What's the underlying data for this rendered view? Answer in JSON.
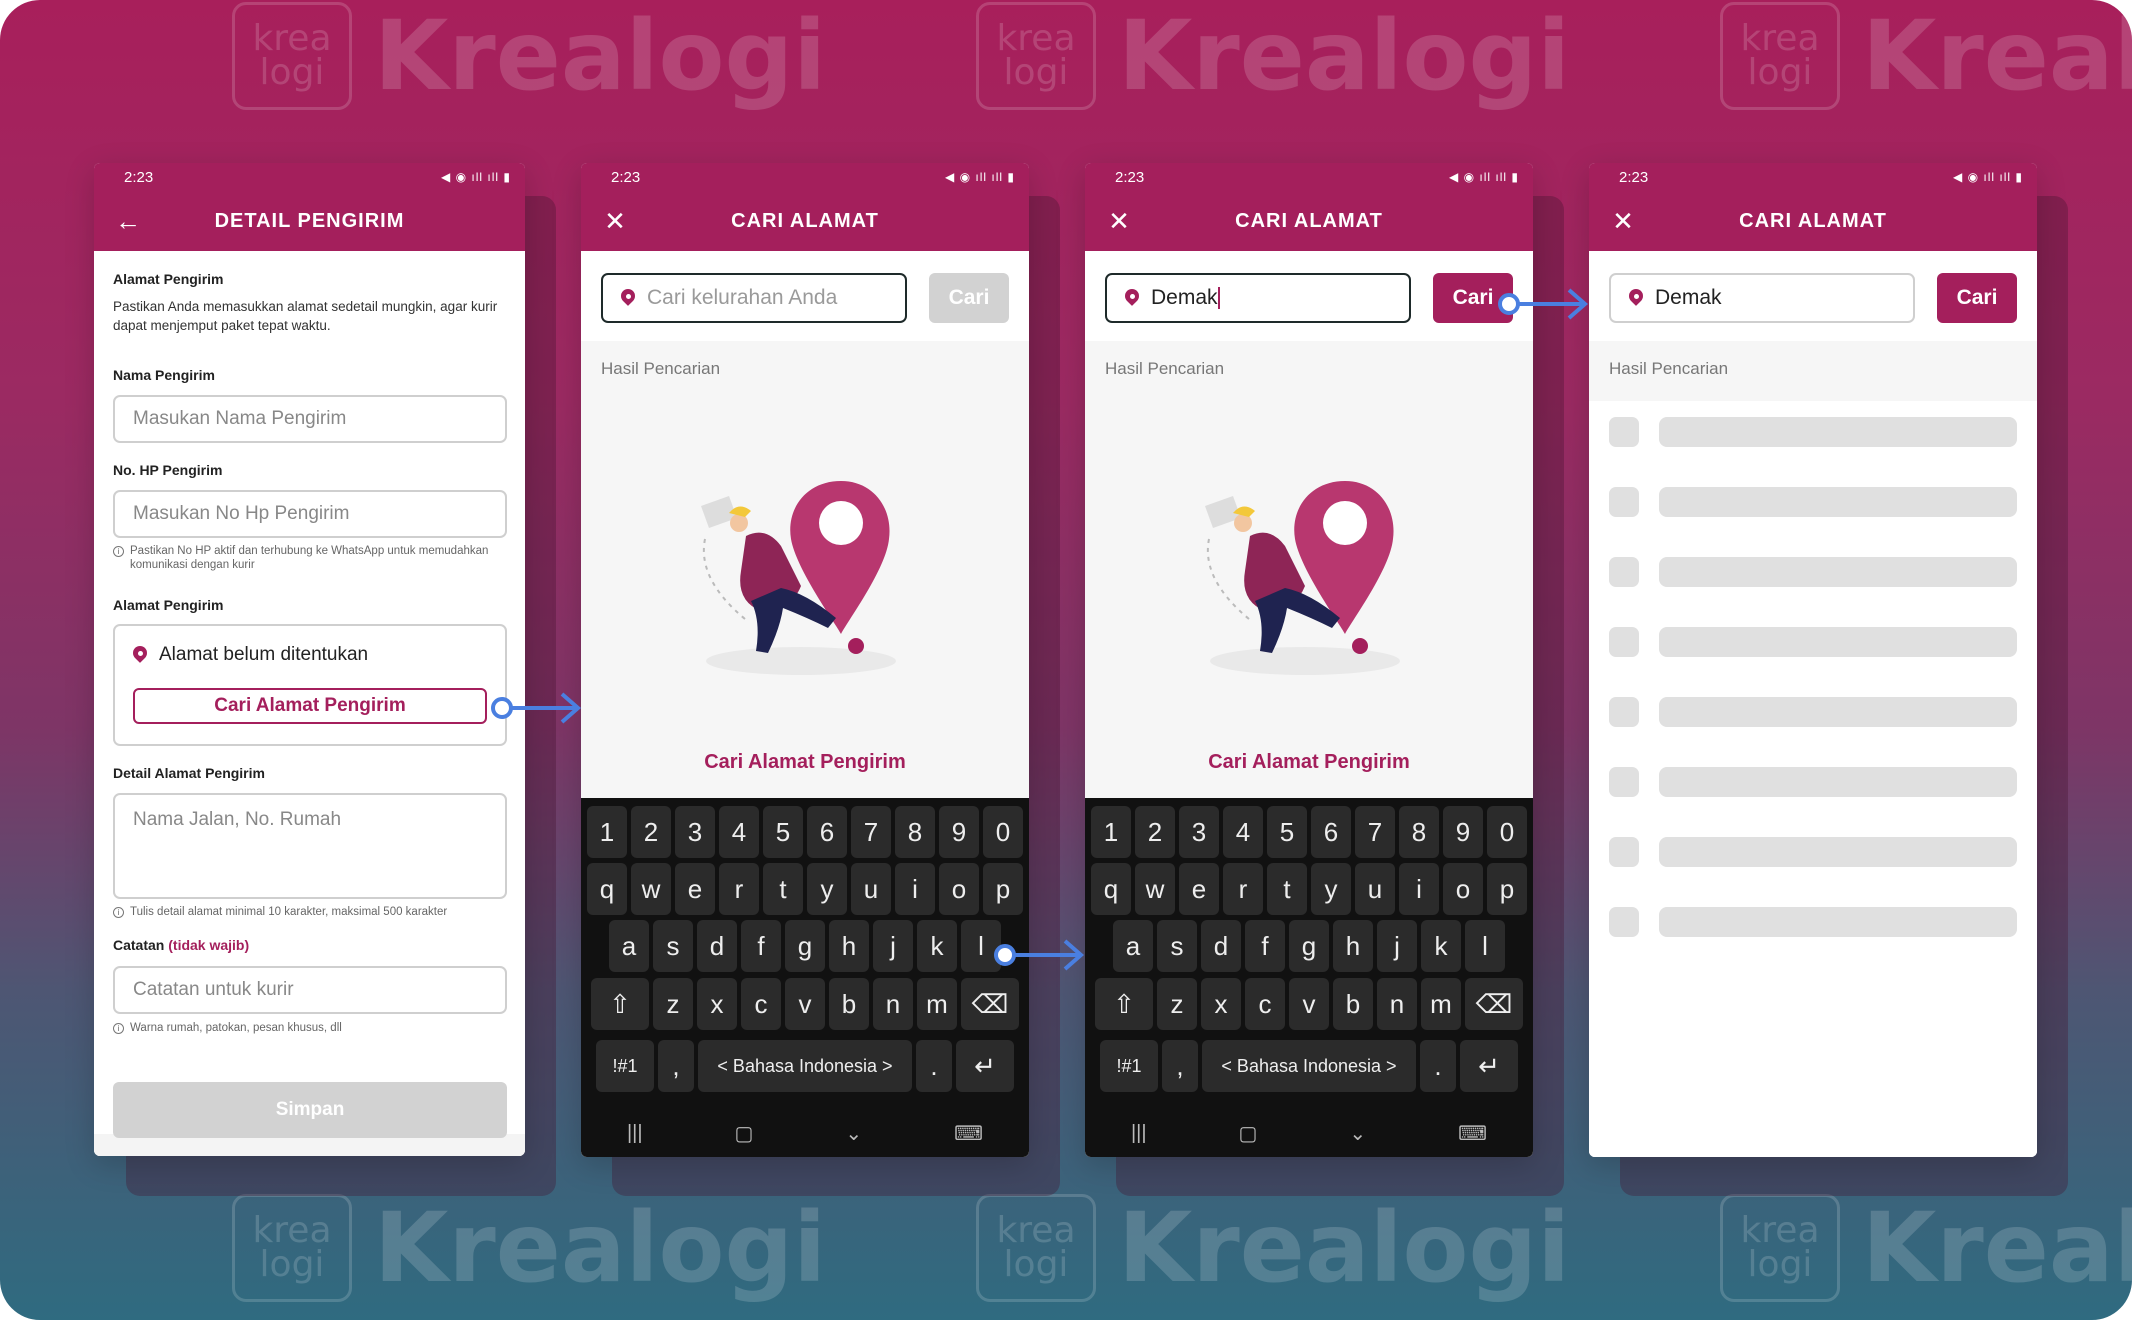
{
  "brand": {
    "mark_line1": "krea",
    "mark_line2": "logi",
    "wordmark": "Krealogi",
    "accent": "#a41f5c"
  },
  "status_time": "2:23",
  "screen1": {
    "title": "DETAIL PENGIRIM",
    "alamat_title": "Alamat Pengirim",
    "alamat_desc": "Pastikan Anda memasukkan alamat sedetail mungkin, agar kurir dapat menjemput paket tepat waktu.",
    "nama_label": "Nama Pengirim",
    "nama_placeholder": "Masukan Nama Pengirim",
    "hp_label": "No. HP Pengirim",
    "hp_placeholder": "Masukan No Hp Pengirim",
    "hp_hint": "Pastikan No HP aktif dan terhubung ke WhatsApp untuk memudahkan komunikasi dengan kurir",
    "alamat_label": "Alamat Pengirim",
    "alamat_value": "Alamat belum ditentukan",
    "cari_button": "Cari Alamat Pengirim",
    "detail_label": "Detail Alamat Pengirim",
    "detail_placeholder": "Nama Jalan, No. Rumah",
    "detail_hint": "Tulis detail alamat minimal 10 karakter, maksimal 500 karakter",
    "catatan_label": "Catatan",
    "catatan_optional": "(tidak wajib)",
    "catatan_placeholder": "Catatan untuk kurir",
    "catatan_hint": "Warna rumah, patokan, pesan khusus, dll",
    "simpan": "Simpan"
  },
  "screen2": {
    "title": "CARI ALAMAT",
    "search_placeholder": "Cari kelurahan Anda",
    "search_button": "Cari",
    "results_label": "Hasil Pencarian",
    "caption": "Cari Alamat Pengirim"
  },
  "screen3": {
    "title": "CARI ALAMAT",
    "search_value": "Demak",
    "search_button": "Cari",
    "results_label": "Hasil Pencarian",
    "caption": "Cari Alamat Pengirim"
  },
  "screen4": {
    "title": "CARI ALAMAT",
    "search_value": "Demak",
    "search_button": "Cari",
    "results_label": "Hasil Pencarian"
  },
  "keyboard": {
    "row1": [
      "1",
      "2",
      "3",
      "4",
      "5",
      "6",
      "7",
      "8",
      "9",
      "0"
    ],
    "row2": [
      "q",
      "w",
      "e",
      "r",
      "t",
      "y",
      "u",
      "i",
      "o",
      "p"
    ],
    "row3": [
      "a",
      "s",
      "d",
      "f",
      "g",
      "h",
      "j",
      "k",
      "l"
    ],
    "row4": [
      "z",
      "x",
      "c",
      "v",
      "b",
      "n",
      "m"
    ],
    "symbols": "!#1",
    "comma": ",",
    "language": "<  Bahasa Indonesia  >",
    "period": "."
  }
}
